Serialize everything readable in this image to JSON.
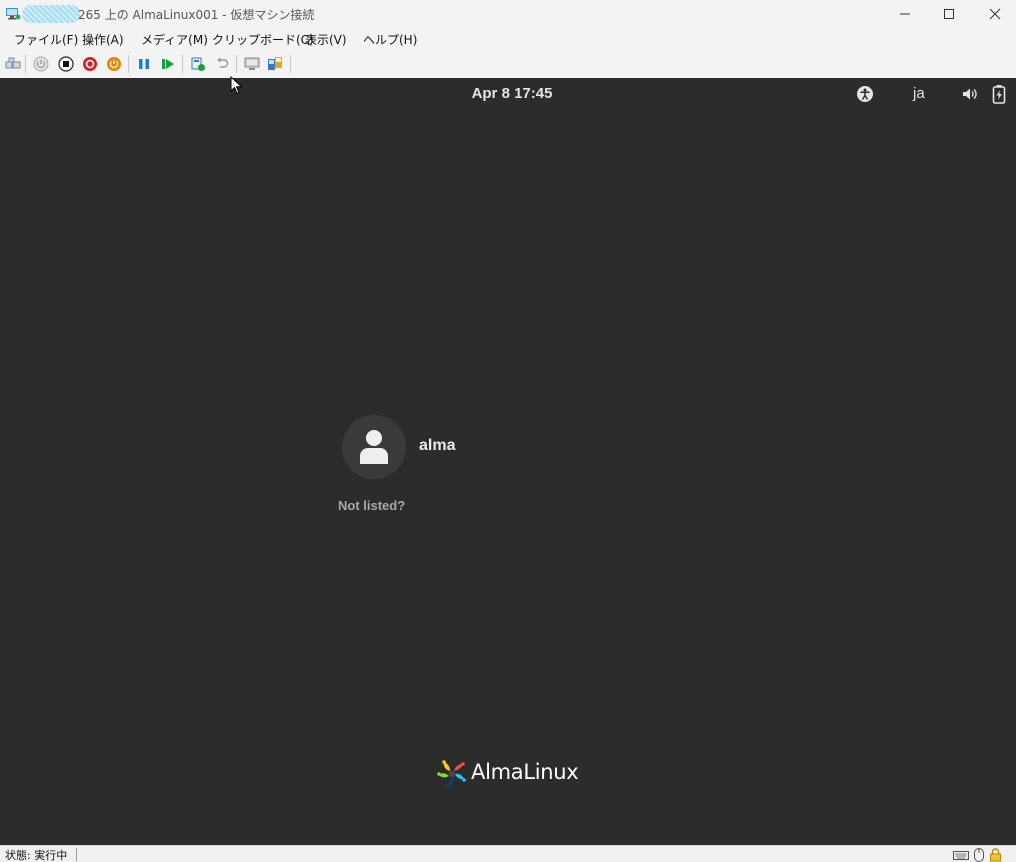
{
  "window": {
    "title": "265 上の AlmaLinux001 - 仮想マシン接続"
  },
  "menu": {
    "items": [
      {
        "label": "ファイル(F)"
      },
      {
        "label": "操作(A)"
      },
      {
        "label": "メディア(M)"
      },
      {
        "label": "クリップボード(C)"
      },
      {
        "label": "表示(V)"
      },
      {
        "label": "ヘルプ(H)"
      }
    ]
  },
  "toolbar": {
    "icons": [
      "ctrl-alt-del-icon",
      "start-icon",
      "turn-off-icon",
      "shut-down-icon",
      "save-state-icon",
      "pause-icon",
      "resume-icon",
      "checkpoint-icon",
      "revert-icon",
      "enhanced-session-icon",
      "basic-session-icon"
    ]
  },
  "vm": {
    "clock": "Apr 8  17:45",
    "language": "ja",
    "user": {
      "name": "alma"
    },
    "not_listed": "Not listed?",
    "brand": "AlmaLinux"
  },
  "status": {
    "text": "状態: 実行中"
  },
  "colors": {
    "vm_background": "#2c2c2c",
    "chrome_background": "#f3f3f3",
    "resume_green": "#18a13a",
    "pause_blue": "#1e7bd6",
    "turnoff_red": "#d42020",
    "shutdown_orange": "#e8860c"
  }
}
